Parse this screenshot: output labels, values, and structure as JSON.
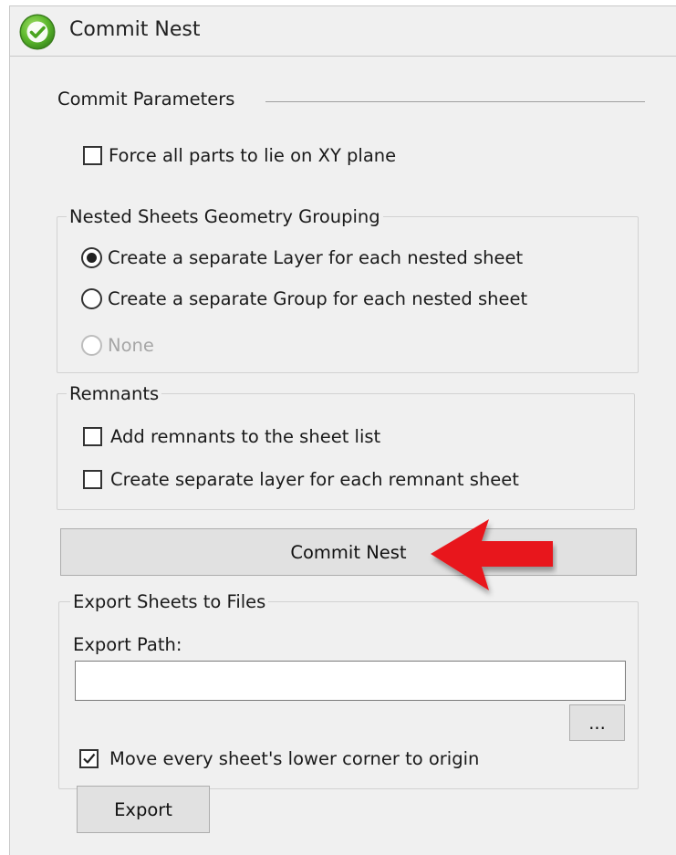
{
  "window": {
    "title": "Commit Nest",
    "icon": "check-circle-icon"
  },
  "commit_parameters": {
    "label": "Commit Parameters",
    "force_xy": {
      "label": "Force all parts to lie on XY plane",
      "checked": false
    }
  },
  "grouping": {
    "title": "Nested Sheets Geometry Grouping",
    "options": [
      {
        "label": "Create a separate Layer for each nested sheet",
        "selected": true,
        "enabled": true
      },
      {
        "label": "Create a separate Group for each nested sheet",
        "selected": false,
        "enabled": true
      },
      {
        "label": "None",
        "selected": false,
        "enabled": false
      }
    ]
  },
  "remnants": {
    "title": "Remnants",
    "options": [
      {
        "label": "Add remnants to the sheet list",
        "checked": false
      },
      {
        "label": "Create separate layer for each remnant sheet",
        "checked": false
      }
    ]
  },
  "commit_button": {
    "label": "Commit Nest"
  },
  "annotation": {
    "icon": "red-arrow-icon",
    "color": "#e8141b"
  },
  "export": {
    "title": "Export Sheets to Files",
    "path_label": "Export Path:",
    "path_value": "",
    "browse_label": "...",
    "move_origin": {
      "label": "Move every sheet's  lower corner to origin",
      "checked": true
    },
    "export_label": "Export"
  },
  "colors": {
    "panel_bg": "#f0f0f0",
    "icon_green": "#5cb82c",
    "arrow_red": "#e8141b"
  }
}
